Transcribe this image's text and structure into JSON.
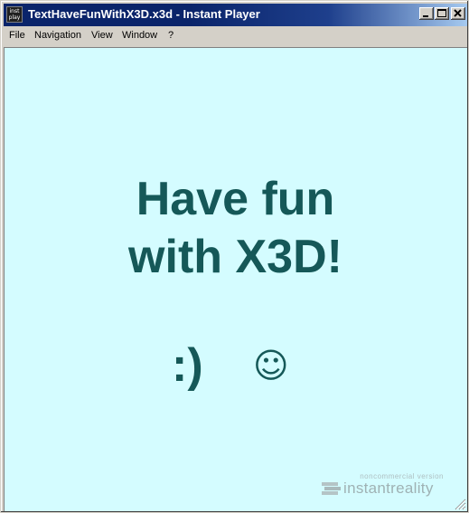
{
  "window": {
    "title": "TextHaveFunWithX3D.x3d - Instant Player",
    "icon_label_top": "inst",
    "icon_label_bottom": "play"
  },
  "menu": {
    "items": [
      {
        "label": "File"
      },
      {
        "label": "Navigation"
      },
      {
        "label": "View"
      },
      {
        "label": "Window"
      },
      {
        "label": "?"
      }
    ]
  },
  "scene": {
    "line1": "Have fun",
    "line2": "with X3D!",
    "emoticon": ":)",
    "smiley": "☺",
    "text_color": "#155858",
    "background_color": "#d4fcff"
  },
  "watermark": {
    "small": "noncommercial version",
    "big": "instantreality"
  },
  "colors": {
    "titlebar": "#0a246a",
    "chrome": "#d4d0c8"
  }
}
